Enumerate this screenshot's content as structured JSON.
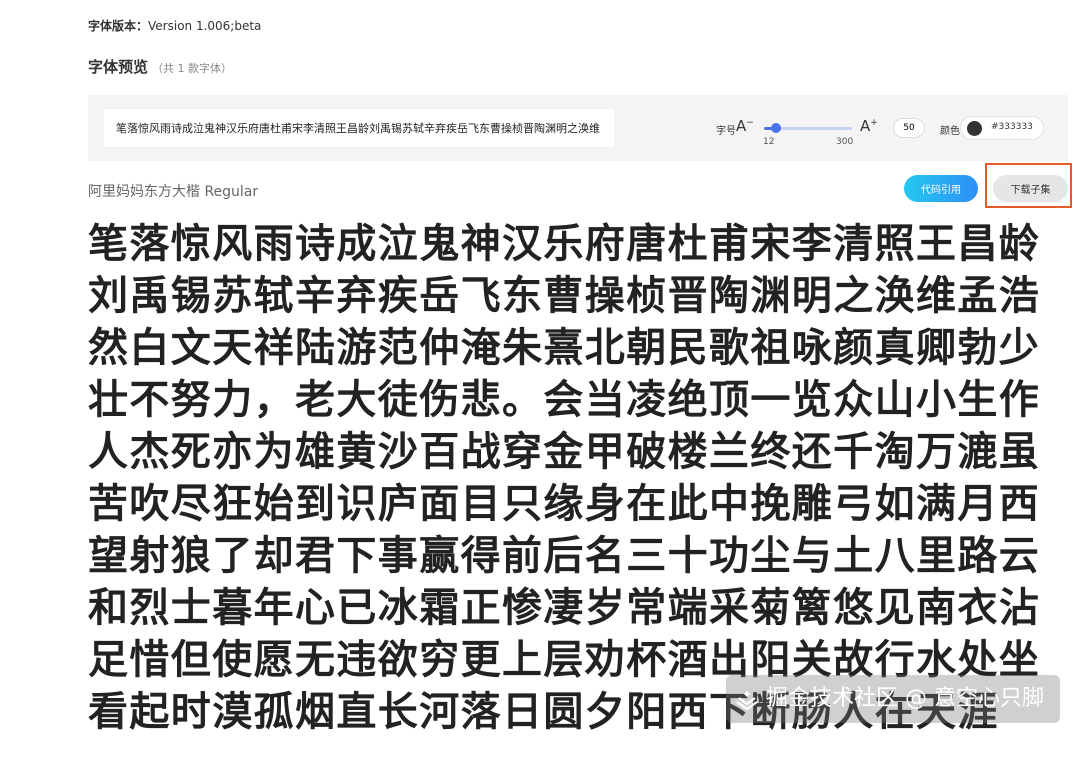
{
  "header": {
    "version_label": "字体版本：",
    "version_value": "Version 1.006;beta",
    "preview_title": "字体预览",
    "preview_count": "（共 1 款字体）"
  },
  "toolbar": {
    "sample_text": "笔落惊风雨诗成泣鬼神汉乐府唐杜甫宋李清照王昌龄刘禹锡苏轼辛弃疾岳飞东曹操桢晋陶渊明之涣维",
    "size_label": "字号",
    "a_minus": "A",
    "a_minus_sup": "−",
    "a_plus": "A",
    "a_plus_sup": "+",
    "slider_min": "12",
    "slider_max": "300",
    "slider_value_fraction": 0.133,
    "size_value": "50",
    "color_label": "颜色",
    "color_hex": "#333333",
    "color_swatch": "#333333"
  },
  "font": {
    "name": "阿里妈妈东方大楷 Regular",
    "cite_button": "代码引用",
    "download_button": "下载子集",
    "preview": "笔落惊风雨诗成泣鬼神汉乐府唐杜甫宋李清照王昌龄刘禹锡苏轼辛弃疾岳飞东曹操桢晋陶渊明之涣维孟浩然白文天祥陆游范仲淹朱熹北朝民歌祖咏颜真卿勃少壮不努力，老大徒伤悲。会当凌绝顶一览众山小生作人杰死亦为雄黄沙百战穿金甲破楼兰终还千淘万漉虽苦吹尽狂始到识庐面目只缘身在此中挽雕弓如满月西望射狼了却君下事赢得前后名三十功尘与土八里路云和烈士暮年心已冰霜正惨凄岁常端采菊篱悠见南衣沾足惜但使愿无违欲穷更上层劝杯酒出阳关故行水处坐看起时漠孤烟直长河落日圆夕阳西下断肠人在天涯"
  },
  "watermark": {
    "text": "掘金技术社区 @ 意空心只脚"
  },
  "colors": {
    "accent": "#4a72ea",
    "highlight": "#e55a2b",
    "cite_gradient_start": "#25c8f0",
    "cite_gradient_end": "#2d8ff6"
  }
}
